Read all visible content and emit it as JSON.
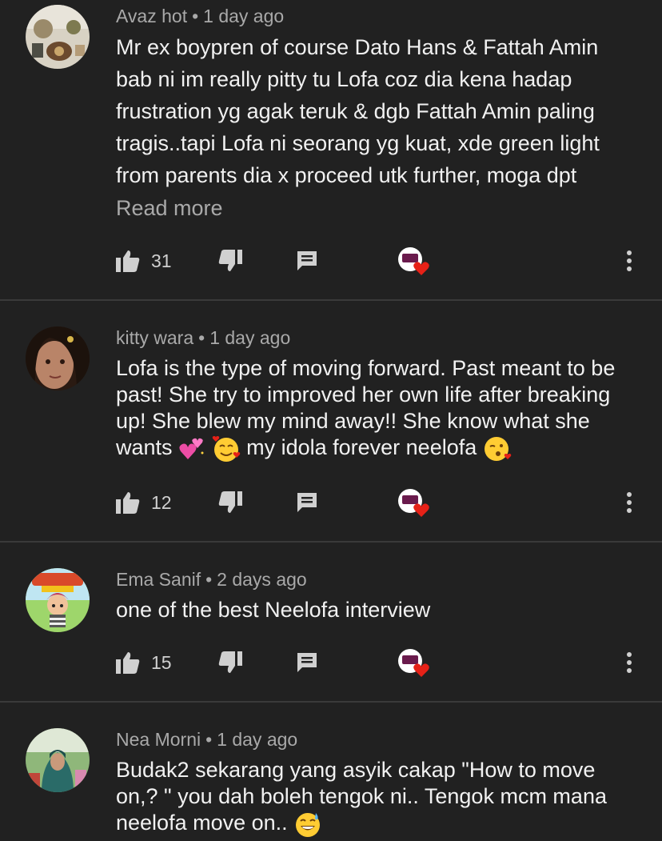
{
  "comments": [
    {
      "author": "Avaz hot",
      "time": "1 day ago",
      "lines": [
        "Mr ex boypren of course Dato Hans & Fattah Amin",
        "bab ni im really pitty tu Lofa coz dia kena hadap",
        "frustration  yg agak teruk & dgb Fattah Amin paling",
        "tragis..tapi Lofa ni seorang yg kuat, xde green light",
        "from parents dia x proceed utk further, moga dpt"
      ],
      "read_more": "Read more",
      "likes": "31"
    },
    {
      "author": "kitty wara",
      "time": "1 day ago",
      "lines": [
        "Lofa is the type of moving forward. Past meant to be",
        "past! She try to improved her own life after breaking",
        "up! She blew my mind away!! She know what she"
      ],
      "line4_a": "wants",
      "line4_b": "my idola forever neelofa",
      "likes": "12"
    },
    {
      "author": "Ema Sanif",
      "time": "2 days ago",
      "lines": [
        "one of the best Neelofa interview"
      ],
      "likes": "15"
    },
    {
      "author": "Nea Morni",
      "time": "1 day ago",
      "lines": [
        "Budak2 sekarang yang asyik cakap \"How to move",
        "on,? \" you dah boleh tengok ni.. Tengok mcm mana"
      ],
      "line3": "neelofa move on.."
    }
  ],
  "dot": "•",
  "colors": {
    "background": "#212121",
    "meta": "#a9a9a9",
    "text": "#f1f1f1",
    "heart": "#e62117"
  }
}
